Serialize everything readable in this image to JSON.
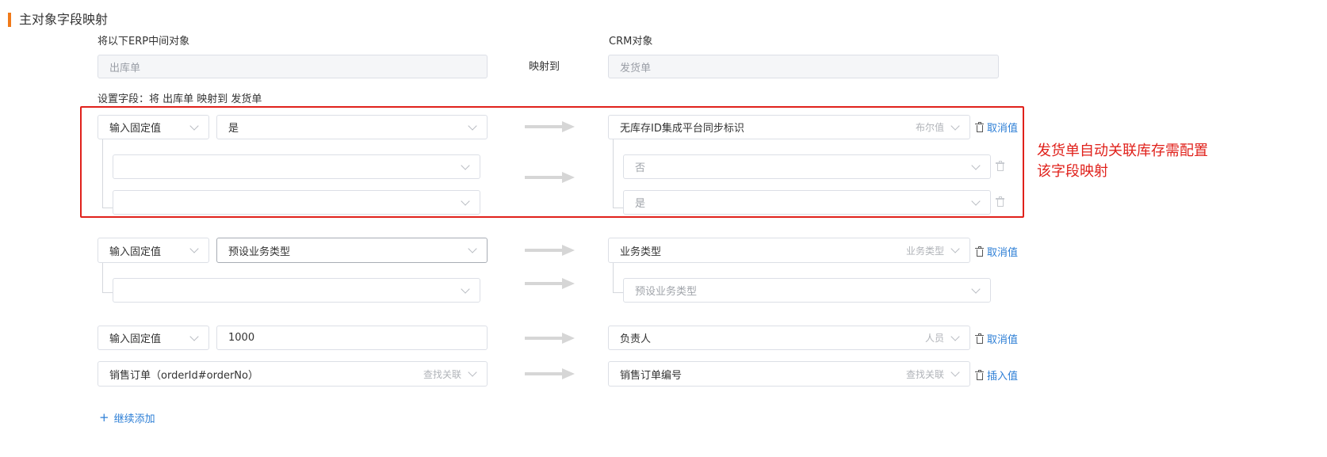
{
  "section": {
    "title": "主对象字段映射"
  },
  "source": {
    "label": "将以下ERP中间对象",
    "value": "出库单"
  },
  "mapping_label": "映射到",
  "target": {
    "label": "CRM对象",
    "value": "发货单"
  },
  "setup_label": "设置字段：将 出库单 映射到 发货单",
  "annotation": "发货单自动关联库存需配置\n该字段映射",
  "rows": [
    {
      "type_value": "输入固定值",
      "value": "是",
      "target_field": "无库存ID集成平台同步标识",
      "target_hint": "布尔值",
      "action": "取消值",
      "subs": [
        {
          "source_value": "",
          "target_value": "否"
        },
        {
          "source_value": "",
          "target_value": "是"
        }
      ]
    },
    {
      "type_value": "输入固定值",
      "value": "预设业务类型",
      "target_field": "业务类型",
      "target_hint": "业务类型",
      "action": "取消值",
      "subs": [
        {
          "source_value": "",
          "target_value": "预设业务类型"
        }
      ]
    },
    {
      "type_value": "输入固定值",
      "value": "1000",
      "target_field": "负责人",
      "target_hint": "人员",
      "action": "取消值"
    },
    {
      "source_field": "销售订单（orderId#orderNo）",
      "source_hint": "查找关联",
      "target_field": "销售订单编号",
      "target_hint": "查找关联",
      "action": "插入值"
    }
  ],
  "add_more": "继续添加",
  "icons": [
    "chevron-down-icon",
    "arrow-right-icon",
    "trash-icon",
    "plus-icon"
  ],
  "colors": {
    "accent": "#f07a1a",
    "link": "#2e7fd6",
    "highlight": "#e0211b"
  }
}
